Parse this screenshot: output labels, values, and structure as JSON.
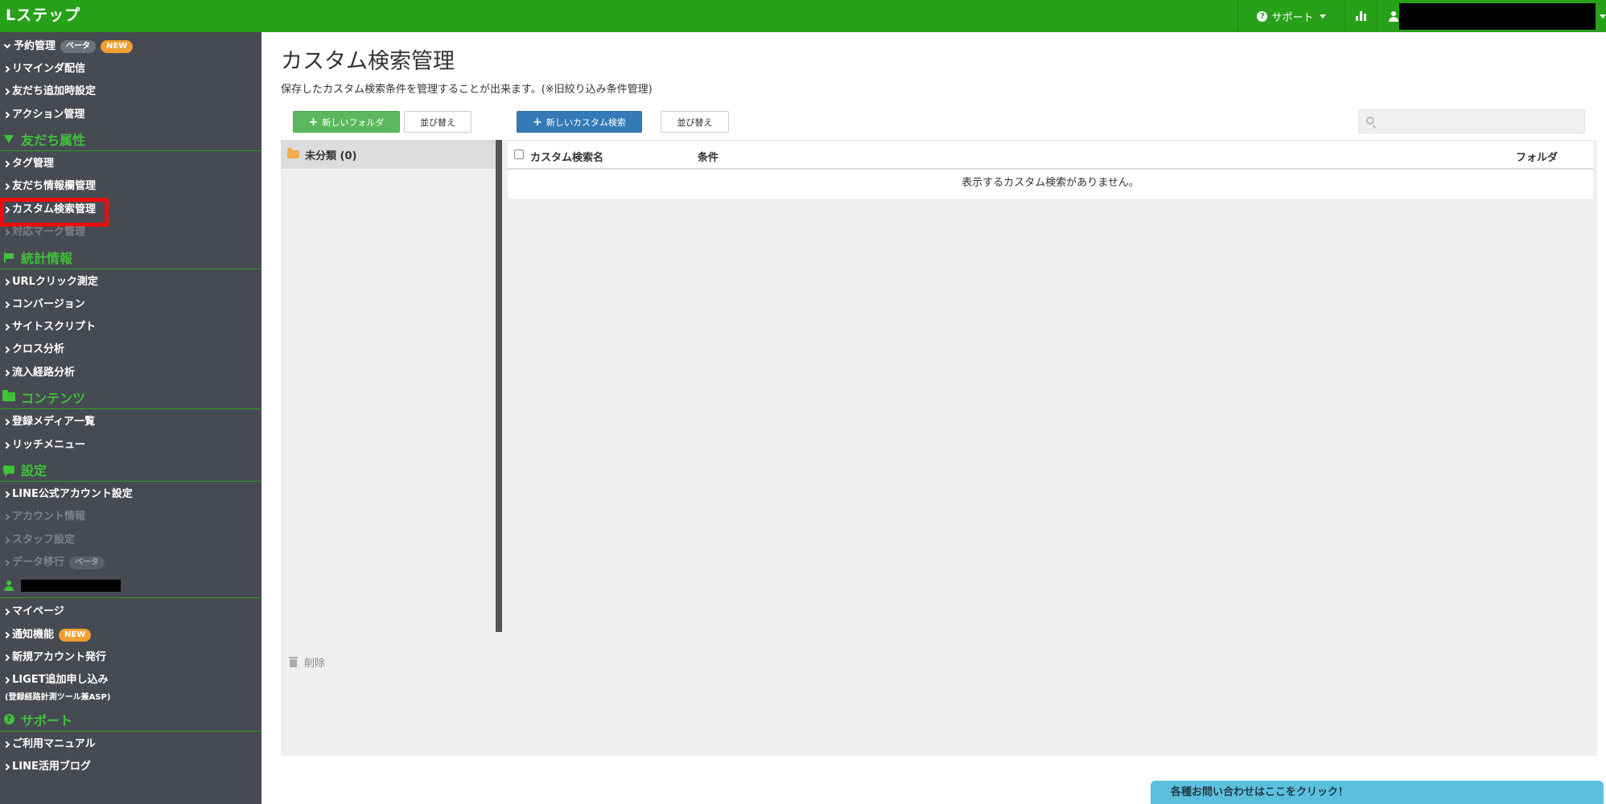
{
  "header": {
    "logo": "Lステップ",
    "support_label": "サポート",
    "icons": [
      "question-circle-icon",
      "caret-down-icon",
      "bar-chart-icon",
      "user-icon"
    ]
  },
  "sidebar": {
    "items_top": [
      {
        "label": "予約管理",
        "badges": [
          "ベータ",
          "NEW"
        ]
      },
      {
        "label": "リマインダ配信"
      },
      {
        "label": "友だち追加時設定"
      },
      {
        "label": "アクション管理"
      }
    ],
    "section_friends": "友だち属性",
    "friends_items": [
      {
        "label": "タグ管理"
      },
      {
        "label": "友だち情報欄管理"
      },
      {
        "label": "カスタム検索管理"
      },
      {
        "label": "対応マーク管理"
      }
    ],
    "section_stats": "統計情報",
    "stats_items": [
      {
        "label": "URLクリック測定"
      },
      {
        "label": "コンバージョン"
      },
      {
        "label": "サイトスクリプト"
      },
      {
        "label": "クロス分析"
      },
      {
        "label": "流入経路分析"
      }
    ],
    "section_contents": "コンテンツ",
    "contents_items": [
      {
        "label": "登録メディア一覧"
      },
      {
        "label": "リッチメニュー"
      }
    ],
    "section_settings": "設定",
    "settings_items": [
      {
        "label": "LINE公式アカウント設定"
      },
      {
        "label": "アカウント情報"
      },
      {
        "label": "スタッフ設定"
      },
      {
        "label": "データ移行",
        "badge": "ベータ"
      }
    ],
    "account_items": [
      {
        "label": "マイページ"
      },
      {
        "label": "通知機能",
        "badge": "NEW"
      },
      {
        "label": "新規アカウント発行"
      },
      {
        "label": "LIGET追加申し込み",
        "note": "(登録経路計測ツール兼ASP)"
      }
    ],
    "section_support": "サポート",
    "support_items": [
      {
        "label": "ご利用マニュアル"
      },
      {
        "label": "LINE活用ブログ"
      }
    ]
  },
  "main": {
    "title": "カスタム検索管理",
    "description": "保存したカスタム検索条件を管理することが出来ます。(※旧絞り込み条件管理)",
    "new_folder_label": "新しいフォルダ",
    "sort_label_1": "並び替え",
    "new_search_label": "新しいカスタム検索",
    "sort_label_2": "並び替え",
    "search_placeholder": "",
    "folder_name": "未分類 (0)",
    "table": {
      "columns": [
        "カスタム検索名",
        "条件",
        "フォルダ"
      ],
      "empty_message": "表示するカスタム検索がありません。"
    },
    "delete_label": "削除",
    "contact_label": "各種お問い合わせはここをクリック！"
  },
  "colors": {
    "brand_green": "#27a11a",
    "sidebar_bg": "#474a52",
    "section_green": "#3fc23a",
    "button_green": "#5cb85c",
    "button_blue": "#337ab7",
    "highlight_red": "#ec0d0d",
    "contact_bg": "#5bc0de"
  }
}
